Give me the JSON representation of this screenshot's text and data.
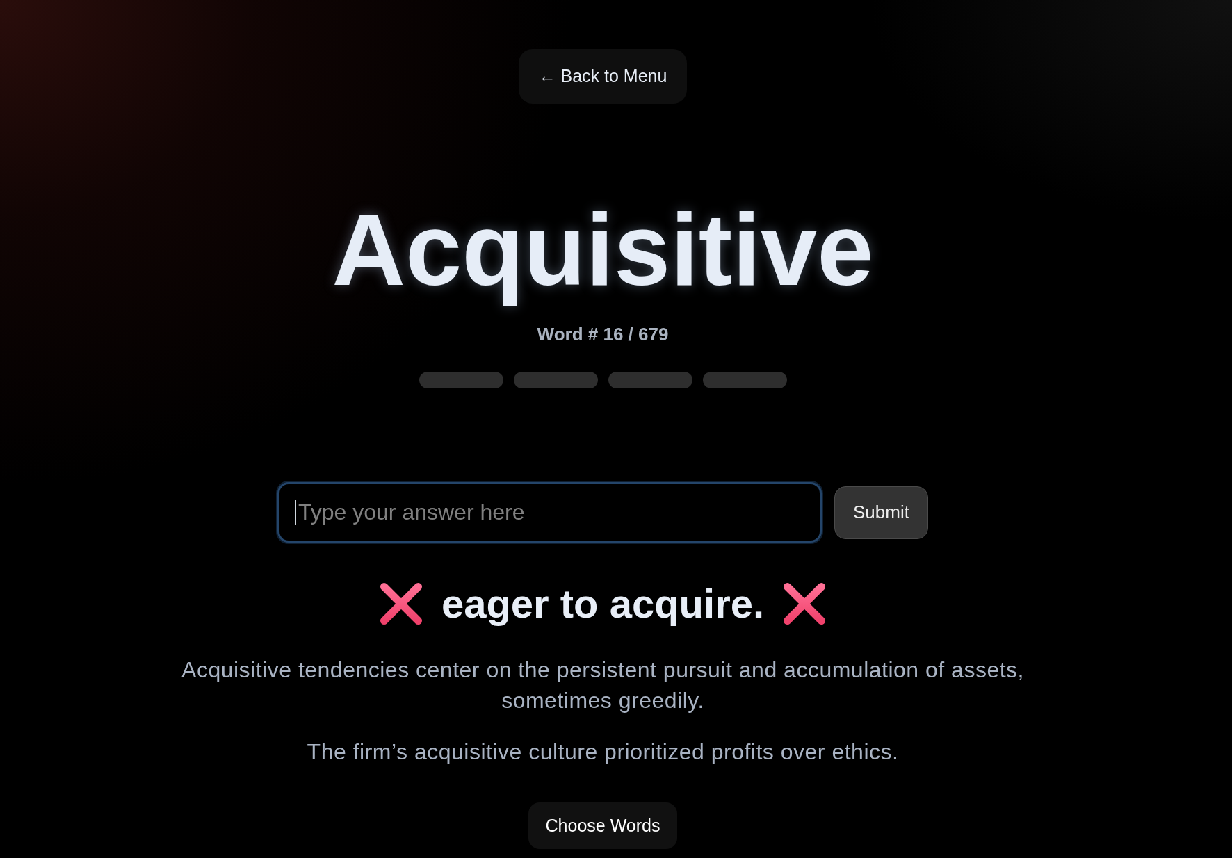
{
  "back_button": {
    "label": "← Back to Menu"
  },
  "word": {
    "title": "Acquisitive",
    "counter": "Word # 16 / 679"
  },
  "progress_segments": [
    {
      "filled": false
    },
    {
      "filled": false
    },
    {
      "filled": false
    },
    {
      "filled": false
    }
  ],
  "answer": {
    "placeholder": "Type your answer here",
    "focused": true
  },
  "submit_button": {
    "label": "Submit"
  },
  "feedback": {
    "correct": false,
    "text": "eager to acquire."
  },
  "explanation": "Acquisitive tendencies center on the persistent pursuit and accumulation of assets, sometimes greedily.",
  "example": "The firm’s acquisitive culture prioritized profits over ethics.",
  "choose_words_button": {
    "label": "Choose Words"
  }
}
